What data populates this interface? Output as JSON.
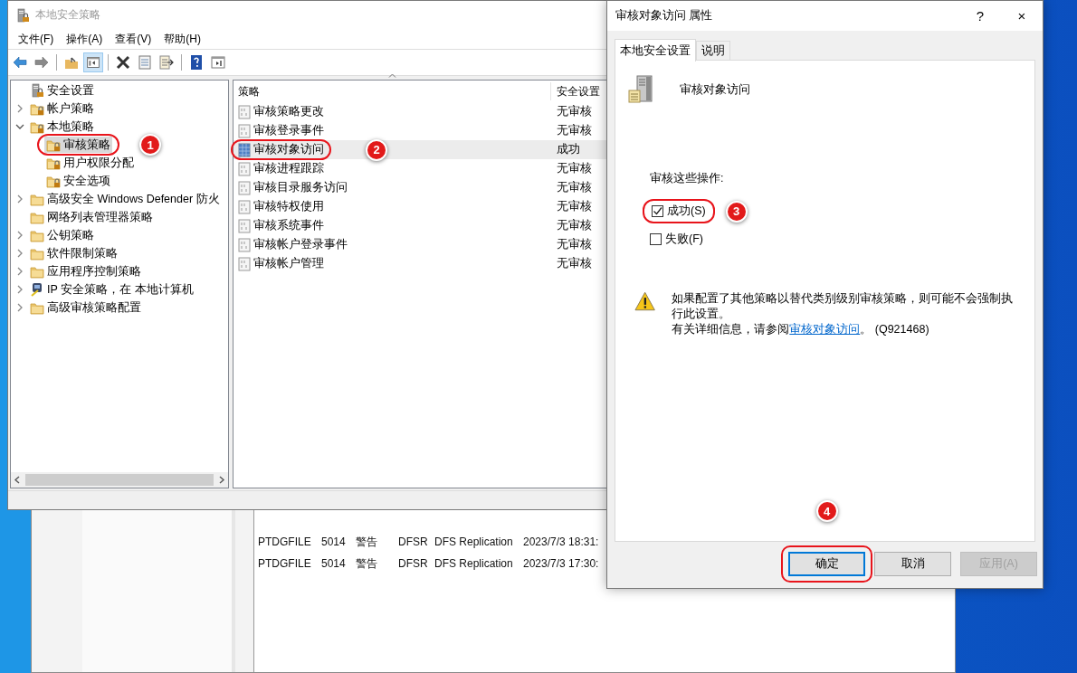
{
  "background_window": {
    "rows": [
      {
        "cells": [
          "PTDGFILE",
          "5014",
          "警告",
          "DFSR",
          "DFS Replication",
          "2023/7/3 18:31:"
        ]
      },
      {
        "cells": [
          "PTDGFILE",
          "5014",
          "警告",
          "DFSR",
          "DFS Replication",
          "2023/7/3 17:30:"
        ]
      }
    ]
  },
  "main_window": {
    "title": "本地安全策略",
    "menu": [
      "文件(F)",
      "操作(A)",
      "查看(V)",
      "帮助(H)"
    ],
    "toolbar": [
      {
        "kind": "back",
        "pressed": false
      },
      {
        "kind": "forward",
        "pressed": false
      },
      {
        "kind": "up",
        "pressed": false
      },
      {
        "kind": "tree",
        "pressed": true
      },
      {
        "kind": "delete",
        "pressed": false
      },
      {
        "kind": "properties",
        "pressed": false
      },
      {
        "kind": "export",
        "pressed": false
      },
      {
        "kind": "help",
        "pressed": false
      },
      {
        "kind": "panel",
        "pressed": false
      }
    ],
    "tree": [
      {
        "label": "安全设置",
        "kind": "server",
        "expandable": false,
        "selected": false,
        "children": [
          {
            "label": "帐户策略",
            "kind": "folder_lock",
            "expandable": true,
            "expanded": false,
            "selected": false
          },
          {
            "label": "本地策略",
            "kind": "folder_lock",
            "expandable": true,
            "expanded": true,
            "selected": false,
            "children": [
              {
                "label": "审核策略",
                "kind": "folder_lock",
                "expandable": false,
                "selected": true,
                "callout": "1"
              },
              {
                "label": "用户权限分配",
                "kind": "folder_lock",
                "expandable": false,
                "selected": false
              },
              {
                "label": "安全选项",
                "kind": "folder_lock",
                "expandable": false,
                "selected": false
              }
            ]
          },
          {
            "label": "高级安全 Windows Defender 防火",
            "kind": "folder",
            "expandable": true,
            "expanded": false,
            "selected": false
          },
          {
            "label": "网络列表管理器策略",
            "kind": "folder",
            "expandable": false,
            "selected": false
          },
          {
            "label": "公钥策略",
            "kind": "folder",
            "expandable": true,
            "expanded": false,
            "selected": false
          },
          {
            "label": "软件限制策略",
            "kind": "folder",
            "expandable": true,
            "expanded": false,
            "selected": false
          },
          {
            "label": "应用程序控制策略",
            "kind": "folder",
            "expandable": true,
            "expanded": false,
            "selected": false
          },
          {
            "label": "IP 安全策略，在 本地计算机",
            "kind": "ip",
            "expandable": true,
            "expanded": false,
            "selected": false
          },
          {
            "label": "高级审核策略配置",
            "kind": "folder",
            "expandable": true,
            "expanded": false,
            "selected": false
          }
        ]
      }
    ],
    "columns": [
      "策略",
      "安全设置"
    ],
    "policies": [
      {
        "name": "审核策略更改",
        "setting": "无审核",
        "selected": false
      },
      {
        "name": "审核登录事件",
        "setting": "无审核",
        "selected": false
      },
      {
        "name": "审核对象访问",
        "setting": "成功",
        "selected": true,
        "callout": "2"
      },
      {
        "name": "审核进程跟踪",
        "setting": "无审核",
        "selected": false
      },
      {
        "name": "审核目录服务访问",
        "setting": "无审核",
        "selected": false
      },
      {
        "name": "审核特权使用",
        "setting": "无审核",
        "selected": false
      },
      {
        "name": "审核系统事件",
        "setting": "无审核",
        "selected": false
      },
      {
        "name": "审核帐户登录事件",
        "setting": "无审核",
        "selected": false
      },
      {
        "name": "审核帐户管理",
        "setting": "无审核",
        "selected": false
      }
    ]
  },
  "dialog": {
    "title": "审核对象访问 属性",
    "help": "?",
    "close": "×",
    "tabs": [
      {
        "label": "本地安全设置",
        "selected": true
      },
      {
        "label": "说明",
        "selected": false
      }
    ],
    "policy_name": "审核对象访问",
    "actions_label": "审核这些操作:",
    "checkboxes": [
      {
        "label": "成功(S)",
        "checked": true,
        "callout": "3"
      },
      {
        "label": "失败(F)",
        "checked": false
      }
    ],
    "warning": {
      "text": "如果配置了其他策略以替代类别级别审核策略，则可能不会强制执行此设置。",
      "info_prefix": "有关详细信息，请参阅",
      "link": "审核对象访问",
      "info_suffix": "。 (Q921468)"
    },
    "buttons": [
      {
        "label": "确定",
        "focused": true,
        "disabled": false,
        "callout": "4"
      },
      {
        "label": "取消",
        "focused": false,
        "disabled": false
      },
      {
        "label": "应用(A)",
        "focused": false,
        "disabled": true
      }
    ]
  }
}
